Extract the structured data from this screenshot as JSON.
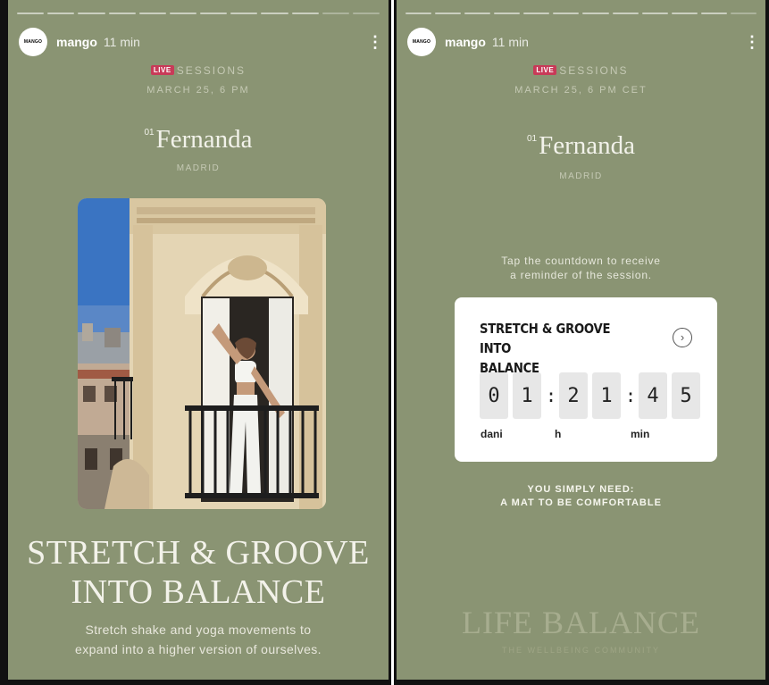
{
  "left_story": {
    "account": {
      "avatar_text": "MANGO",
      "username": "mango",
      "time": "11 min"
    },
    "live_badge": "LIVE",
    "sessions": "SESSIONS",
    "date": "MARCH 25, 6 PM",
    "index": "01",
    "name": "Fernanda",
    "city": "MADRID",
    "title_line1": "STRETCH & GROOVE",
    "title_line2": "INTO BALANCE",
    "desc_line1": "Stretch shake and yoga movements to",
    "desc_line2": "expand into a higher version of ourselves."
  },
  "right_story": {
    "account": {
      "avatar_text": "MANGO",
      "username": "mango",
      "time": "11 min"
    },
    "live_badge": "LIVE",
    "sessions": "SESSIONS",
    "date": "MARCH 25, 6 PM CET",
    "index": "01",
    "name": "Fernanda",
    "city": "MADRID",
    "instruction_line1": "Tap the countdown to receive",
    "instruction_line2": "a reminder of the session.",
    "countdown": {
      "title_line1": "STRETCH & GROOVE INTO",
      "title_line2": "BALANCE",
      "arrow": "›",
      "digits": [
        "0",
        "1",
        "2",
        "1",
        "4",
        "5"
      ],
      "colon": ":",
      "units": {
        "days": "dani",
        "hours": "h",
        "minutes": "min"
      }
    },
    "need_line1": "YOU SIMPLY NEED:",
    "need_line2": "A MAT TO BE COMFORTABLE",
    "brand": "LIFE BALANCE",
    "brand_sub": "THE WELLBEING COMMUNITY"
  },
  "more_icon": "⋮",
  "colors": {
    "background": "#8a9473",
    "live": "#c83a58",
    "card": "#ffffff"
  }
}
